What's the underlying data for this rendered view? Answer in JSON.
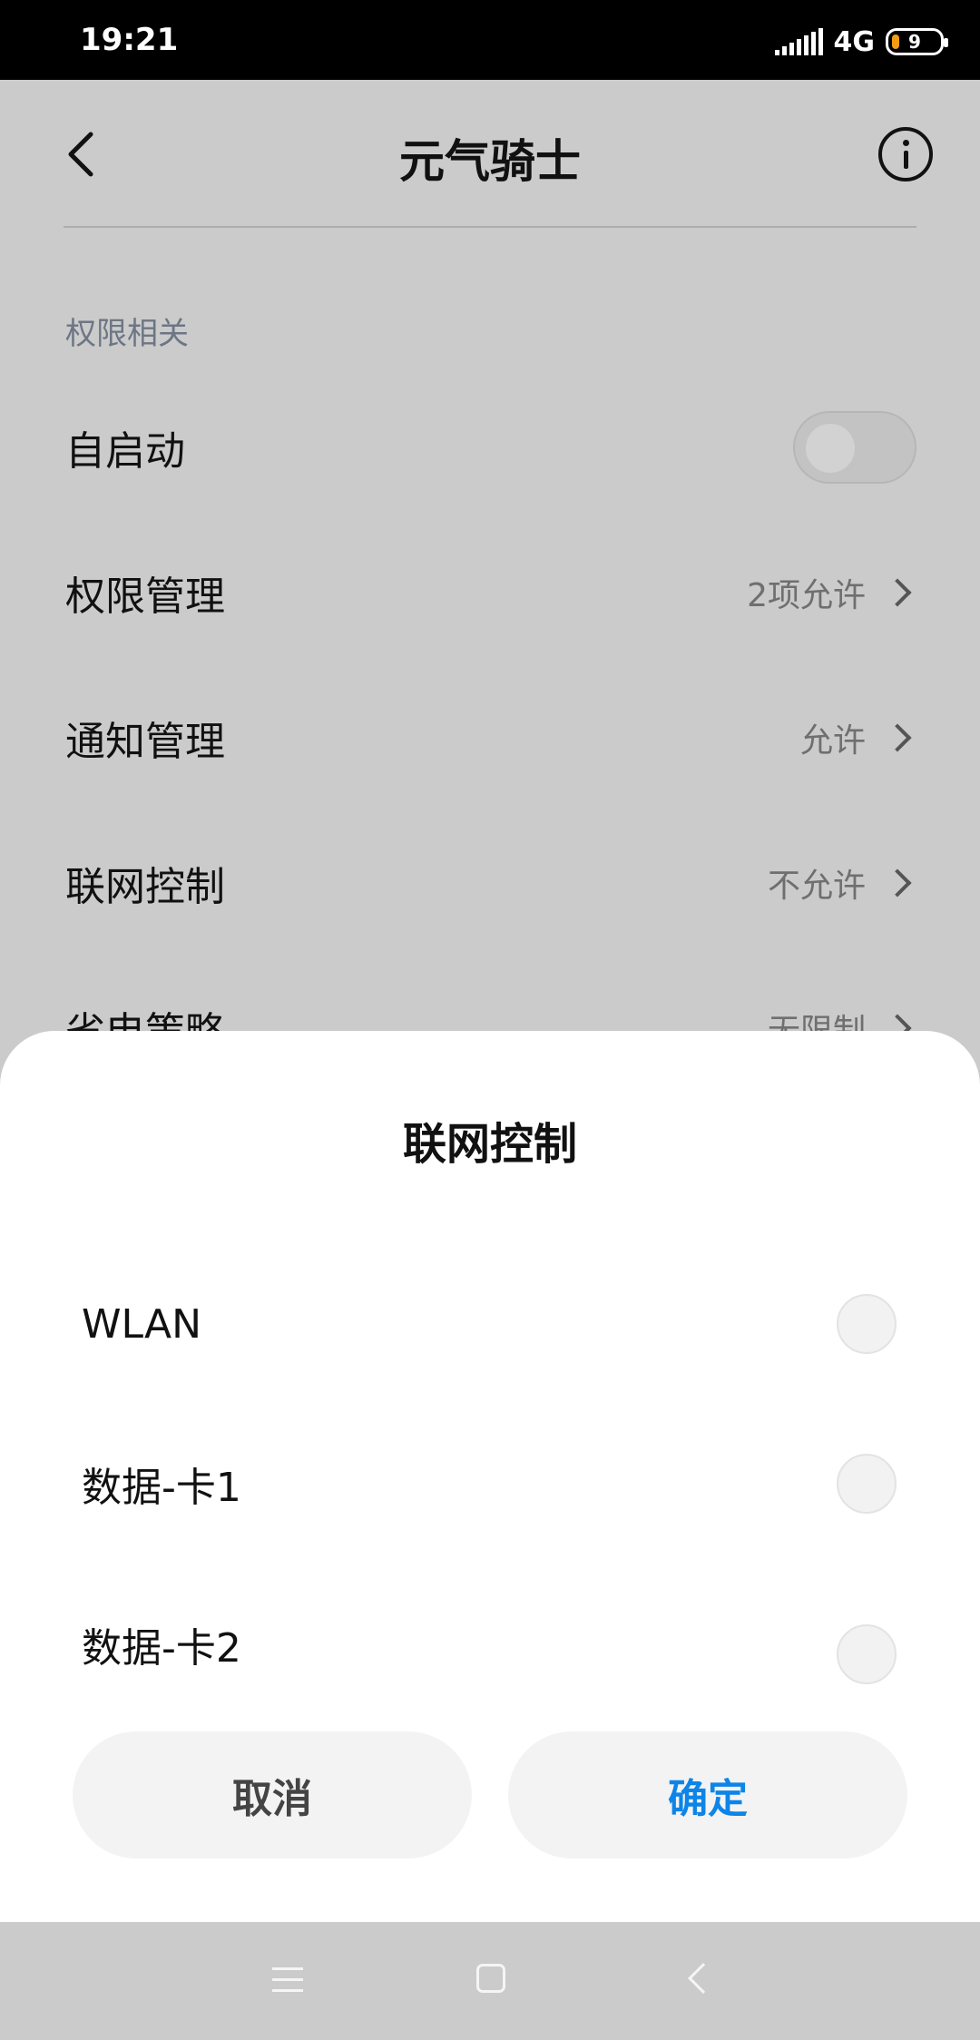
{
  "status_bar": {
    "time": "19:21",
    "network": "4G",
    "battery_level": "9"
  },
  "header": {
    "title": "元气骑士",
    "back_icon": "chevron-left-icon",
    "info_icon": "info-circle-icon"
  },
  "settings": {
    "section_label": "权限相关",
    "autostart": {
      "label": "自启动",
      "enabled": false
    },
    "rows": [
      {
        "label": "权限管理",
        "value": "2项允许"
      },
      {
        "label": "通知管理",
        "value": "允许"
      },
      {
        "label": "联网控制",
        "value": "不允许"
      },
      {
        "label": "省电策略",
        "value": "无限制"
      }
    ]
  },
  "dialog": {
    "title": "联网控制",
    "options": [
      {
        "label": "WLAN",
        "checked": false
      },
      {
        "label": "数据-卡1",
        "checked": false
      },
      {
        "label": "数据-卡2",
        "checked": false
      }
    ],
    "cancel_label": "取消",
    "confirm_label": "确定"
  },
  "colors": {
    "accent": "#0d84e8",
    "scrim": "#cbcbcb",
    "section_label": "#6d7684"
  },
  "nav_bar": {
    "icons": [
      "menu-icon",
      "home-icon",
      "back-icon"
    ]
  }
}
